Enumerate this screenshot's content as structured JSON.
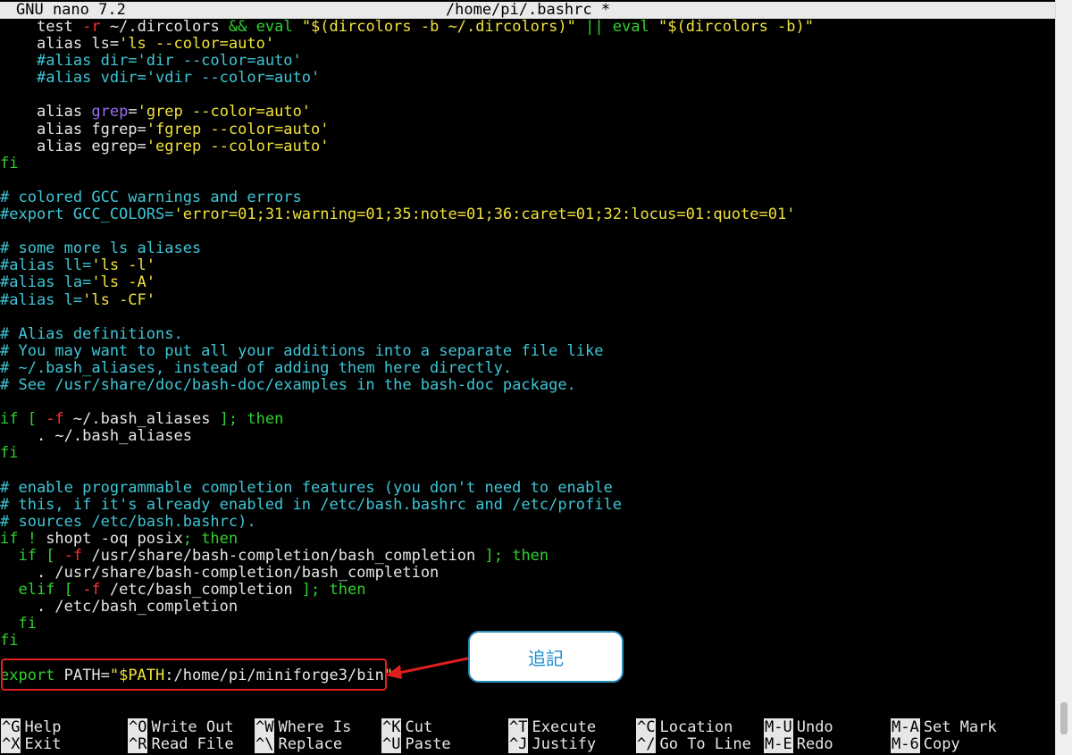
{
  "window": {
    "app_name": "GNU nano 7.2",
    "file_title": "/home/pi/.bashrc *"
  },
  "editor": {
    "lines": [
      {
        "indent": "    ",
        "segments": [
          {
            "t": "test ",
            "c": "w"
          },
          {
            "t": "-r",
            "c": "r"
          },
          {
            "t": " ~/.dircolors ",
            "c": "w"
          },
          {
            "t": "&& eval",
            "c": "g"
          },
          {
            "t": " \"$(dircolors -b ~/.dircolors)\" ",
            "c": "y"
          },
          {
            "t": "|| eval",
            "c": "g"
          },
          {
            "t": " \"$(dircolors -b)\"",
            "c": "y"
          }
        ]
      },
      {
        "indent": "    ",
        "segments": [
          {
            "t": "alias ls=",
            "c": "w"
          },
          {
            "t": "'ls --color=auto'",
            "c": "y"
          }
        ]
      },
      {
        "indent": "    ",
        "segments": [
          {
            "t": "#alias dir='dir --color=auto'",
            "c": "c"
          }
        ]
      },
      {
        "indent": "    ",
        "segments": [
          {
            "t": "#alias vdir='vdir --color=auto'",
            "c": "c"
          }
        ]
      },
      {
        "indent": "",
        "segments": []
      },
      {
        "indent": "    ",
        "segments": [
          {
            "t": "alias ",
            "c": "w"
          },
          {
            "t": "grep",
            "c": "p"
          },
          {
            "t": "=",
            "c": "w"
          },
          {
            "t": "'grep --color=auto'",
            "c": "y"
          }
        ]
      },
      {
        "indent": "    ",
        "segments": [
          {
            "t": "alias fgrep=",
            "c": "w"
          },
          {
            "t": "'fgrep --color=auto'",
            "c": "y"
          }
        ]
      },
      {
        "indent": "    ",
        "segments": [
          {
            "t": "alias egrep=",
            "c": "w"
          },
          {
            "t": "'egrep --color=auto'",
            "c": "y"
          }
        ]
      },
      {
        "indent": "",
        "segments": [
          {
            "t": "fi",
            "c": "g"
          }
        ]
      },
      {
        "indent": "",
        "segments": []
      },
      {
        "indent": "",
        "segments": [
          {
            "t": "# colored GCC warnings and errors",
            "c": "c"
          }
        ]
      },
      {
        "indent": "",
        "segments": [
          {
            "t": "#export GCC_COLORS=",
            "c": "c"
          },
          {
            "t": "'error=01;31:warning=01;35:note=01;36:caret=01;32:locus=01:quote=01'",
            "c": "y"
          }
        ]
      },
      {
        "indent": "",
        "segments": []
      },
      {
        "indent": "",
        "segments": [
          {
            "t": "# some more ls aliases",
            "c": "c"
          }
        ]
      },
      {
        "indent": "",
        "segments": [
          {
            "t": "#alias ll=",
            "c": "c"
          },
          {
            "t": "'ls -l'",
            "c": "y"
          }
        ]
      },
      {
        "indent": "",
        "segments": [
          {
            "t": "#alias la=",
            "c": "c"
          },
          {
            "t": "'ls -A'",
            "c": "y"
          }
        ]
      },
      {
        "indent": "",
        "segments": [
          {
            "t": "#alias l=",
            "c": "c"
          },
          {
            "t": "'ls -CF'",
            "c": "y"
          }
        ]
      },
      {
        "indent": "",
        "segments": []
      },
      {
        "indent": "",
        "segments": [
          {
            "t": "# Alias definitions.",
            "c": "c"
          }
        ]
      },
      {
        "indent": "",
        "segments": [
          {
            "t": "# You may want to put all your additions into a separate file like",
            "c": "c"
          }
        ]
      },
      {
        "indent": "",
        "segments": [
          {
            "t": "# ~/.bash_aliases, instead of adding them here directly.",
            "c": "c"
          }
        ]
      },
      {
        "indent": "",
        "segments": [
          {
            "t": "# See /usr/share/doc/bash-doc/examples in the bash-doc package.",
            "c": "c"
          }
        ]
      },
      {
        "indent": "",
        "segments": []
      },
      {
        "indent": "",
        "segments": [
          {
            "t": "if [ ",
            "c": "g"
          },
          {
            "t": "-f",
            "c": "r"
          },
          {
            "t": " ~/.bash_aliases ",
            "c": "w"
          },
          {
            "t": "]; then",
            "c": "g"
          }
        ]
      },
      {
        "indent": "    ",
        "segments": [
          {
            "t": ". ~/.bash_aliases",
            "c": "w"
          }
        ]
      },
      {
        "indent": "",
        "segments": [
          {
            "t": "fi",
            "c": "g"
          }
        ]
      },
      {
        "indent": "",
        "segments": []
      },
      {
        "indent": "",
        "segments": [
          {
            "t": "# enable programmable completion features (you don't need to enable",
            "c": "c"
          }
        ]
      },
      {
        "indent": "",
        "segments": [
          {
            "t": "# this, if it's already enabled in /etc/bash.bashrc and /etc/profile",
            "c": "c"
          }
        ]
      },
      {
        "indent": "",
        "segments": [
          {
            "t": "# sources /etc/bash.bashrc).",
            "c": "c"
          }
        ]
      },
      {
        "indent": "",
        "segments": [
          {
            "t": "if ! ",
            "c": "g"
          },
          {
            "t": "shopt -oq posix",
            "c": "w"
          },
          {
            "t": "; then",
            "c": "g"
          }
        ]
      },
      {
        "indent": "  ",
        "segments": [
          {
            "t": "if [ ",
            "c": "g"
          },
          {
            "t": "-f",
            "c": "r"
          },
          {
            "t": " /usr/share/bash-completion/bash_completion ",
            "c": "w"
          },
          {
            "t": "]; then",
            "c": "g"
          }
        ]
      },
      {
        "indent": "    ",
        "segments": [
          {
            "t": ". /usr/share/bash-completion/bash_completion",
            "c": "w"
          }
        ]
      },
      {
        "indent": "  ",
        "segments": [
          {
            "t": "elif [ ",
            "c": "g"
          },
          {
            "t": "-f",
            "c": "r"
          },
          {
            "t": " /etc/bash_completion ",
            "c": "w"
          },
          {
            "t": "]; then",
            "c": "g"
          }
        ]
      },
      {
        "indent": "    ",
        "segments": [
          {
            "t": ". /etc/bash_completion",
            "c": "w"
          }
        ]
      },
      {
        "indent": "  ",
        "segments": [
          {
            "t": "fi",
            "c": "g"
          }
        ]
      },
      {
        "indent": "",
        "segments": [
          {
            "t": "fi",
            "c": "g"
          }
        ]
      },
      {
        "indent": "",
        "segments": []
      },
      {
        "indent": "",
        "segments": [
          {
            "t": "export",
            "c": "g"
          },
          {
            "t": " PATH=",
            "c": "w"
          },
          {
            "t": "\"$PATH",
            "c": "y"
          },
          {
            "t": ":/home/pi/miniforge3/bin",
            "c": "w"
          },
          {
            "t": "\"",
            "c": "y"
          }
        ]
      }
    ]
  },
  "shortcuts": [
    {
      "key": "^G",
      "label": "Help"
    },
    {
      "key": "^O",
      "label": "Write Out"
    },
    {
      "key": "^W",
      "label": "Where Is"
    },
    {
      "key": "^K",
      "label": "Cut"
    },
    {
      "key": "^T",
      "label": "Execute"
    },
    {
      "key": "^C",
      "label": "Location"
    },
    {
      "key": "M-U",
      "label": "Undo"
    },
    {
      "key": "M-A",
      "label": "Set Mark"
    },
    {
      "key": "^X",
      "label": "Exit"
    },
    {
      "key": "^R",
      "label": "Read File"
    },
    {
      "key": "^\\",
      "label": "Replace"
    },
    {
      "key": "^U",
      "label": "Paste"
    },
    {
      "key": "^J",
      "label": "Justify"
    },
    {
      "key": "^/",
      "label": "Go To Line"
    },
    {
      "key": "M-E",
      "label": "Redo"
    },
    {
      "key": "M-6",
      "label": "Copy"
    }
  ],
  "annotation": {
    "callout_text": "追記",
    "accent_color": "#e01e1e",
    "callout_border_color": "#2a8fbd"
  }
}
